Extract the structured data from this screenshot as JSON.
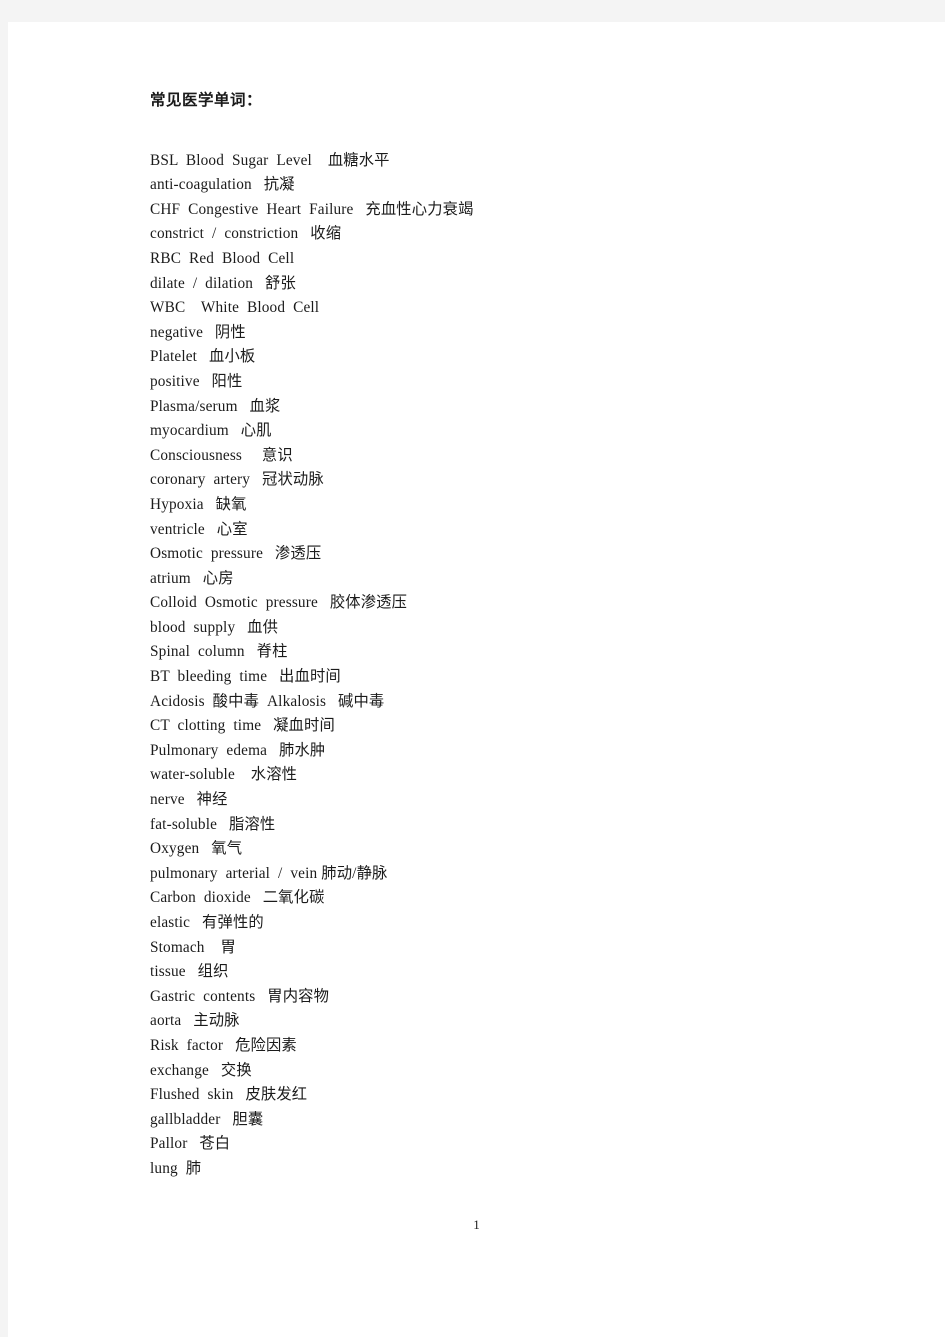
{
  "document": {
    "heading": "常见医学单词：",
    "page_number": "1",
    "entries": [
      "BSL  Blood  Sugar  Level    血糖水平",
      "anti-coagulation   抗凝",
      "CHF  Congestive  Heart  Failure   充血性心力衰竭",
      "constrict  /  constriction   收缩",
      "RBC  Red  Blood  Cell",
      "dilate  /  dilation   舒张",
      "WBC    White  Blood  Cell",
      "negative   阴性",
      "Platelet   血小板",
      "positive   阳性",
      "Plasma/serum   血浆",
      "myocardium   心肌",
      "Consciousness     意识",
      "coronary  artery   冠状动脉",
      "Hypoxia   缺氧",
      "ventricle   心室",
      "Osmotic  pressure   渗透压",
      "atrium   心房",
      "Colloid  Osmotic  pressure   胶体渗透压",
      "blood  supply   血供",
      "Spinal  column   脊柱",
      "BT  bleeding  time   出血时间",
      "Acidosis  酸中毒  Alkalosis   碱中毒",
      "CT  clotting  time   凝血时间",
      "Pulmonary  edema   肺水肿",
      "water-soluble    水溶性",
      "nerve   神经",
      "fat-soluble   脂溶性",
      "Oxygen   氧气",
      "pulmonary  arterial  /  vein 肺动/静脉",
      "Carbon  dioxide   二氧化碳",
      "elastic   有弹性的",
      "Stomach    胃",
      "tissue   组织",
      "Gastric  contents   胃内容物",
      "aorta   主动脉",
      "Risk  factor   危险因素",
      "exchange   交换",
      "Flushed  skin   皮肤发红",
      "gallbladder   胆囊",
      "Pallor   苍白",
      "lung  肺"
    ]
  }
}
